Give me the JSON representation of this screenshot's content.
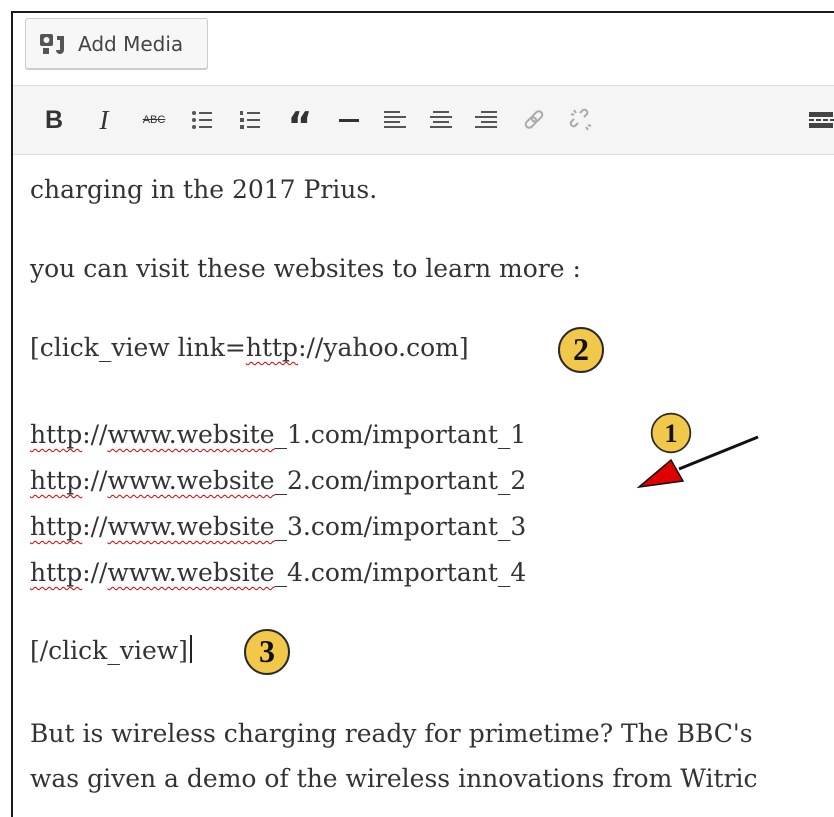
{
  "media_button": {
    "label": "Add Media",
    "icon": "add-media-icon"
  },
  "toolbar": {
    "buttons": [
      {
        "name": "bold",
        "glyph": "B"
      },
      {
        "name": "italic",
        "glyph": "I"
      },
      {
        "name": "strikethrough",
        "glyph": "ABC"
      },
      {
        "name": "bulleted-list"
      },
      {
        "name": "numbered-list"
      },
      {
        "name": "blockquote",
        "glyph": "“"
      },
      {
        "name": "horizontal-line"
      },
      {
        "name": "align-left"
      },
      {
        "name": "align-center"
      },
      {
        "name": "align-right"
      },
      {
        "name": "insert-link"
      },
      {
        "name": "remove-link"
      },
      {
        "name": "read-more"
      }
    ]
  },
  "editor": {
    "line1": "charging in the 2017 Prius.",
    "line2": "you can visit these websites to learn more :",
    "shortcode_open": {
      "pre": "[click_view link=",
      "spell": "http",
      "post": "://yahoo.com]"
    },
    "links": [
      {
        "a": "http",
        "b": "://",
        "c": "www.website",
        "d": "_1.com/important_1"
      },
      {
        "a": "http",
        "b": "://",
        "c": "www.website",
        "d": "_2.com/important_2"
      },
      {
        "a": "http",
        "b": "://",
        "c": "www.website",
        "d": "_3.com/important_3"
      },
      {
        "a": "http",
        "b": "://",
        "c": "www.website",
        "d": "_4.com/important_4"
      }
    ],
    "shortcode_close": "[/click_view]",
    "para1": "But is wireless charging ready for primetime? The BBC's",
    "para2": "was given a demo of the wireless innovations from Witric"
  },
  "annotations": {
    "badge1": "1",
    "badge2": "2",
    "badge3": "3",
    "badge_color": "#f2c84b",
    "arrow_color": "#e00000"
  }
}
